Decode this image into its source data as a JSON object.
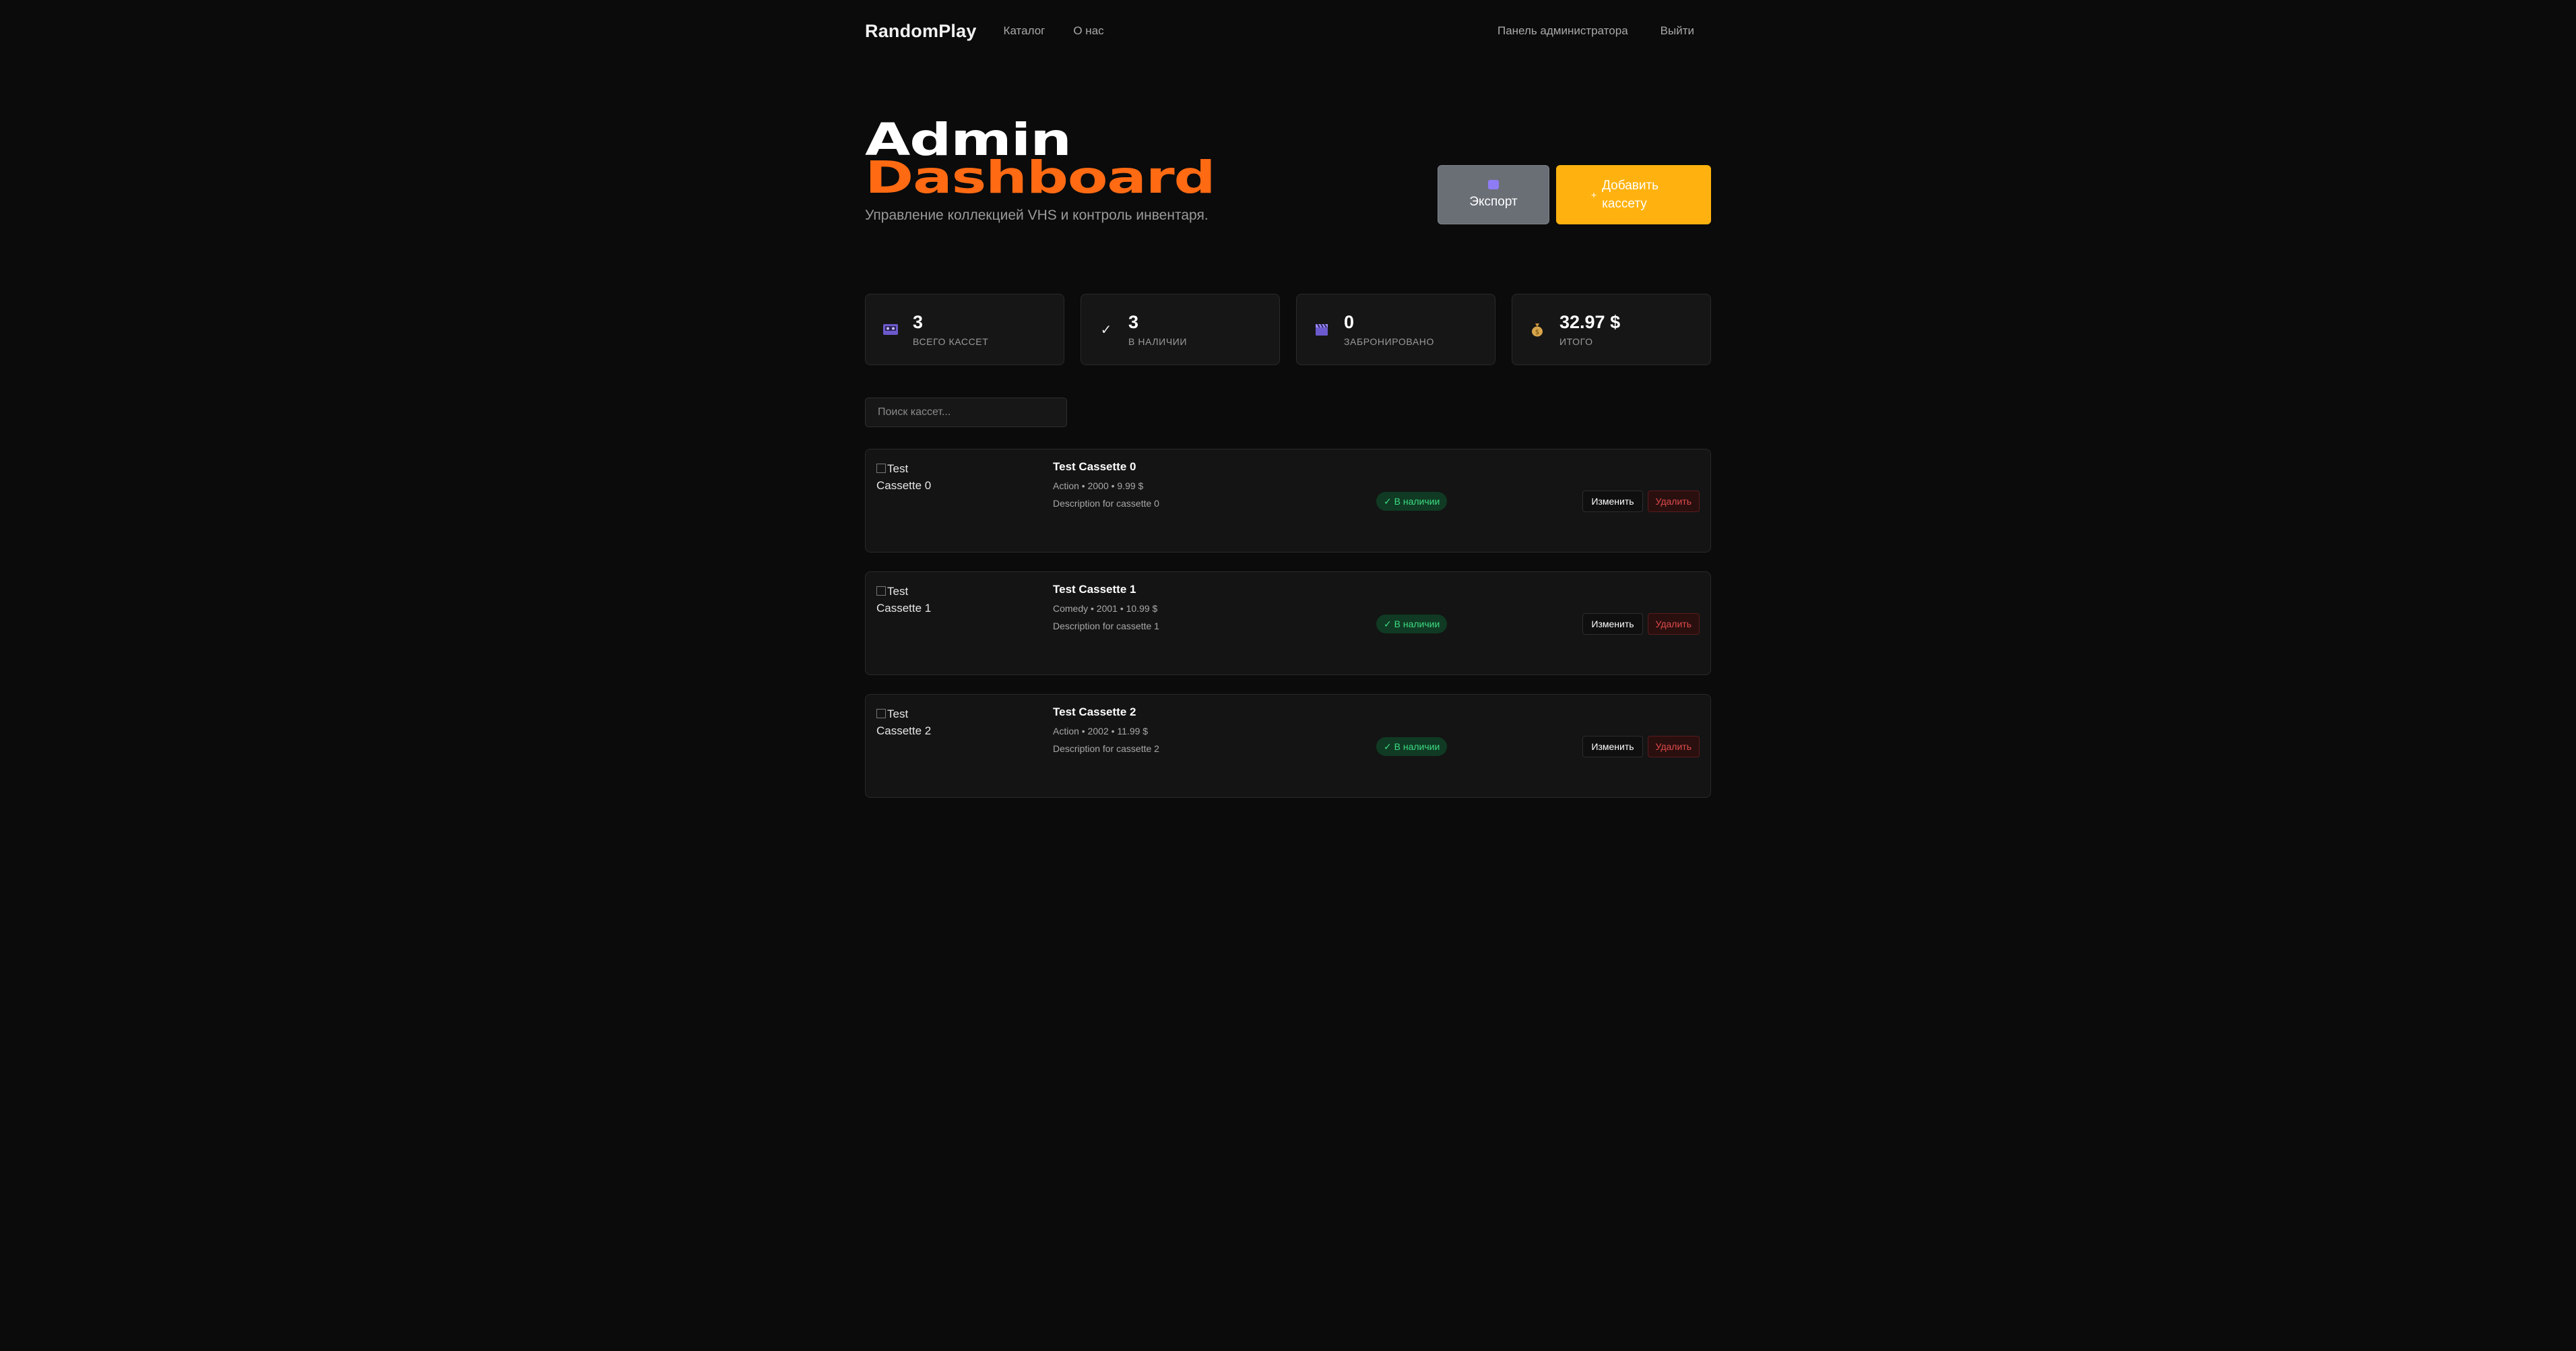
{
  "nav": {
    "brand": "RandomPlay",
    "links": [
      "Каталог",
      "О нас"
    ],
    "right_links": [
      "Панель администратора",
      "Выйти"
    ]
  },
  "hero": {
    "title_line1": "Admin",
    "title_line2": "Dashboard",
    "subtitle": "Управление коллекцией VHS и контроль инвентаря.",
    "export_label": "Экспорт",
    "add_label": "Добавить кассету"
  },
  "stats": [
    {
      "icon": "cassette-icon",
      "value": "3",
      "label": "ВСЕГО КАССЕТ"
    },
    {
      "icon": "check-icon",
      "value": "3",
      "label": "В НАЛИЧИИ"
    },
    {
      "icon": "clapperboard-icon",
      "value": "0",
      "label": "ЗАБРОНИРОВАНО"
    },
    {
      "icon": "money-bag-icon",
      "value": "32.97 $",
      "label": "ИТОГО"
    }
  ],
  "search": {
    "placeholder": "Поиск кассет..."
  },
  "cassettes": [
    {
      "image_alt": "Test Cassette 0",
      "title": "Test Cassette 0",
      "meta": "Action • 2000 • 9.99 $",
      "description": "Description for cassette 0",
      "status": "✓ В наличии",
      "edit_label": "Изменить",
      "delete_label": "Удалить"
    },
    {
      "image_alt": "Test Cassette 1",
      "title": "Test Cassette 1",
      "meta": "Comedy • 2001 • 10.99 $",
      "description": "Description for cassette 1",
      "status": "✓ В наличии",
      "edit_label": "Изменить",
      "delete_label": "Удалить"
    },
    {
      "image_alt": "Test Cassette 2",
      "title": "Test Cassette 2",
      "meta": "Action • 2002 • 11.99 $",
      "description": "Description for cassette 2",
      "status": "✓ В наличии",
      "edit_label": "Изменить",
      "delete_label": "Удалить"
    }
  ],
  "colors": {
    "background": "#0b0b0b",
    "accent_orange": "#ff6a13",
    "button_yellow": "#ffb20f",
    "status_green": "#3ddc84",
    "delete_red": "#e04b4b"
  }
}
